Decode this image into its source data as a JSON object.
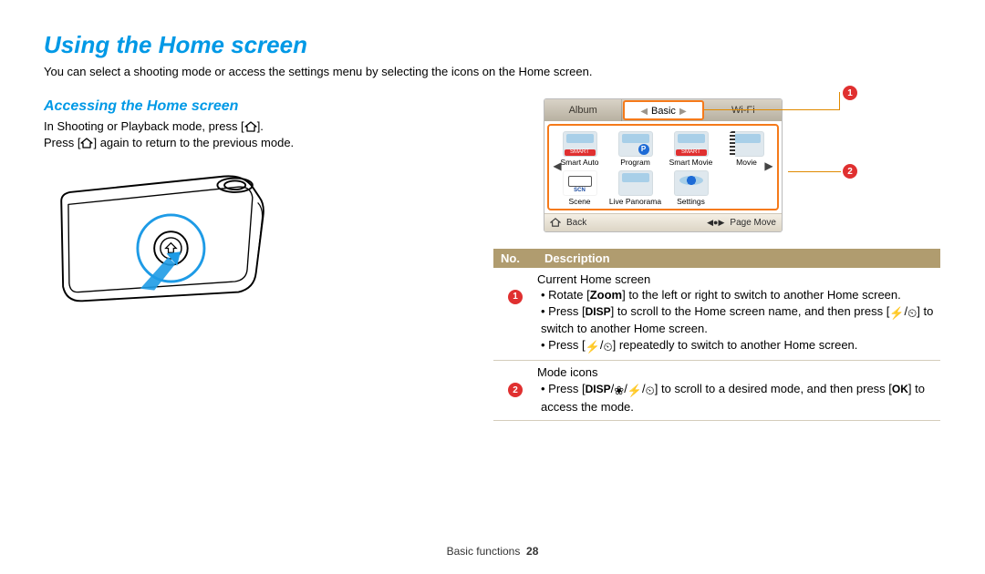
{
  "title": "Using the Home screen",
  "intro": "You can select a shooting mode or access the settings menu by selecting the icons on the Home screen.",
  "section_heading": "Accessing the Home screen",
  "body_line1_a": "In Shooting or Playback mode, press [",
  "body_line1_b": "].",
  "body_line2_a": "Press [",
  "body_line2_b": "] again to return to the previous mode.",
  "screen": {
    "tabs": {
      "left": "Album",
      "center": "Basic",
      "right": "Wi-Fi"
    },
    "modes": {
      "smart_auto": "Smart Auto",
      "program": "Program",
      "smart_movie": "Smart Movie",
      "movie": "Movie",
      "scene": "Scene",
      "live_panorama": "Live Panorama",
      "settings": "Settings"
    },
    "back": "Back",
    "page_move": "Page Move",
    "smart_badge": "SMART"
  },
  "callouts": {
    "one": "1",
    "two": "2"
  },
  "table": {
    "header_no": "No.",
    "header_desc": "Description",
    "row1": {
      "lead": "Current Home screen",
      "b1_a": "Rotate [",
      "b1_zoom": "Zoom",
      "b1_b": "] to the left or right to switch to another Home screen.",
      "b2_a": "Press [",
      "b2_b": "] to scroll to the Home screen name, and then press [",
      "b2_c": "] to switch to another Home screen.",
      "b3_a": "Press [",
      "b3_b": "] repeatedly to switch to another Home screen."
    },
    "row2": {
      "lead": "Mode icons",
      "b1_a": "Press [",
      "b1_b": "] to scroll to a desired mode, and then press [",
      "b1_c": "] to access the mode."
    }
  },
  "footer_label": "Basic functions",
  "footer_page": "28",
  "glyphs": {
    "disp": "DISP",
    "ok": "OK",
    "flash": "⚡",
    "timer": "⏲",
    "macro": "❀"
  }
}
